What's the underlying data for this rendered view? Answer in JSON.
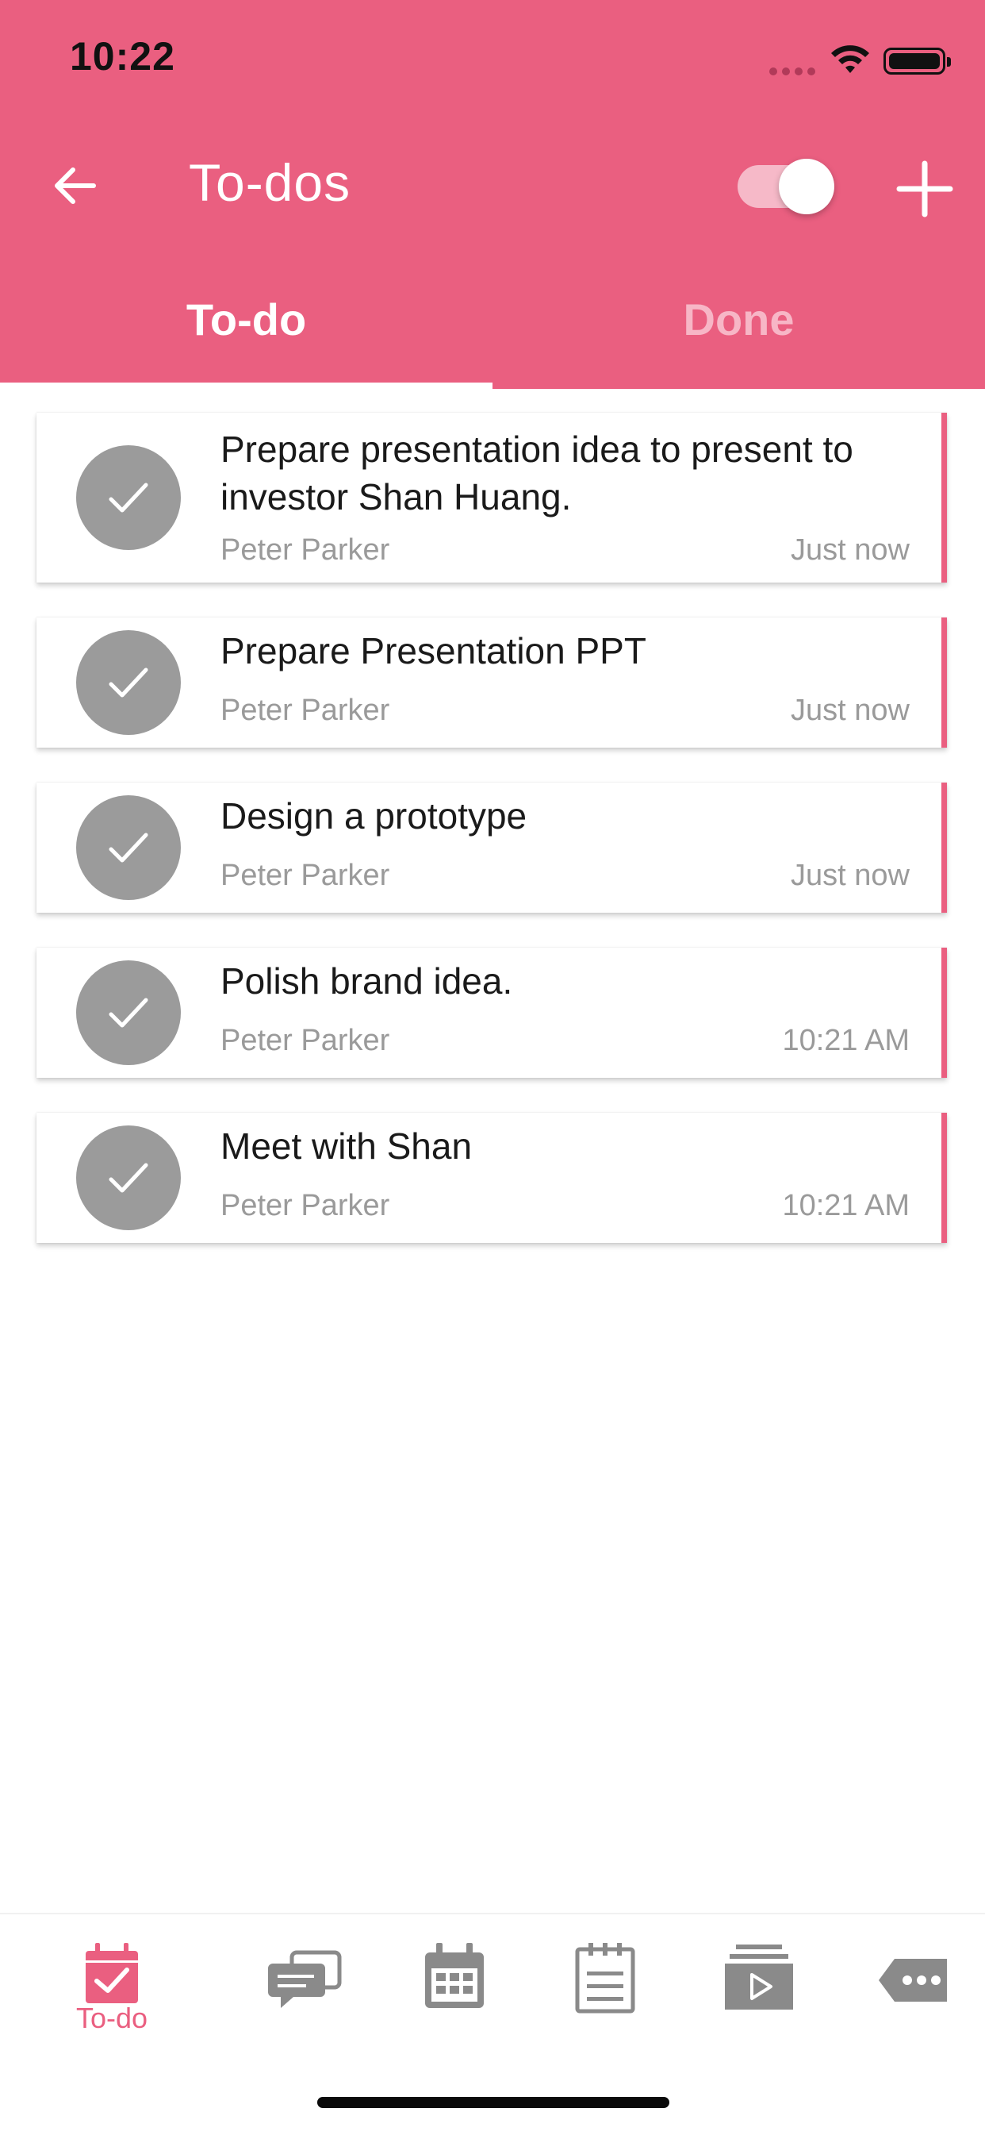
{
  "status_bar": {
    "time": "10:22"
  },
  "header": {
    "title": "To-dos",
    "toggle_on": true,
    "colors": {
      "brand": "#ea5f80"
    }
  },
  "tabs": [
    {
      "label": "To-do",
      "active": true
    },
    {
      "label": "Done",
      "active": false
    }
  ],
  "todos": [
    {
      "title": "Prepare presentation idea to present to investor Shan Huang.",
      "owner": "Peter Parker",
      "time": "Just now"
    },
    {
      "title": "Prepare Presentation PPT",
      "owner": "Peter Parker",
      "time": "Just now"
    },
    {
      "title": "Design a prototype",
      "owner": "Peter Parker",
      "time": "Just now"
    },
    {
      "title": "Polish brand idea.",
      "owner": "Peter Parker",
      "time": "10:21 AM"
    },
    {
      "title": "Meet with Shan",
      "owner": "Peter Parker",
      "time": "10:21 AM"
    }
  ],
  "bottom_nav": {
    "items": [
      {
        "icon": "calendar-check-icon",
        "label": "To-do",
        "active": true
      },
      {
        "icon": "chat-bubbles-icon",
        "active": false
      },
      {
        "icon": "calendar-grid-icon",
        "active": false
      },
      {
        "icon": "notepad-icon",
        "active": false
      },
      {
        "icon": "video-stack-icon",
        "active": false
      },
      {
        "icon": "more-tag-icon",
        "active": false
      }
    ]
  }
}
